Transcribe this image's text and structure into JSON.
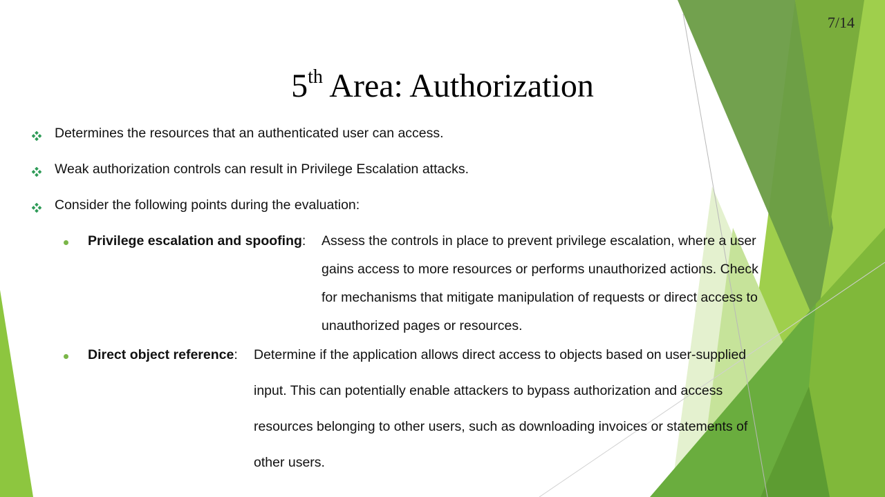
{
  "page_number": "7/14",
  "title": {
    "ordinal": "5",
    "ordinal_suffix": "th",
    "text": "Area: Authorization"
  },
  "bullets": [
    {
      "text": "Determines the resources that an authenticated user can access.",
      "icon": "diamond-bullet-icon"
    },
    {
      "text": "Weak authorization controls can result in Privilege Escalation attacks.",
      "icon": "diamond-bullet-icon"
    },
    {
      "text": "Consider the following points during the evaluation:",
      "icon": "diamond-bullet-icon"
    }
  ],
  "sub_points": [
    {
      "term": "Privilege escalation and spoofing",
      "separator": ":",
      "lines": [
        "Assess the controls in place to prevent privilege escalation, where a user",
        "gains access to more resources or performs unauthorized actions. Check",
        "for mechanisms that mitigate manipulation of requests or direct access to",
        "unauthorized pages or resources."
      ]
    },
    {
      "term": "Direct object reference",
      "separator": ":",
      "lines": [
        "Determine if the application allows direct access to objects based on user-supplied",
        "input. This can potentially enable attackers to bypass authorization and access",
        "resources belonging to other users, such as downloading invoices or statements of",
        "other users."
      ]
    }
  ],
  "colors": {
    "accent_green": "#7ab648",
    "dark_green": "#4e8a2e",
    "bullet_green": "#2e9b57"
  }
}
